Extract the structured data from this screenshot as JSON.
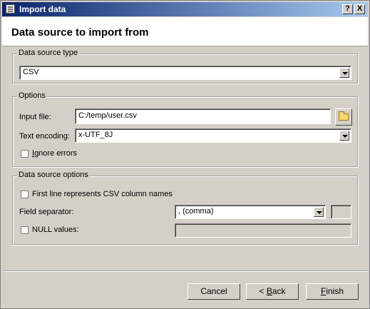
{
  "window": {
    "title": "Import data",
    "help_glyph": "?",
    "close_glyph": "X"
  },
  "header": {
    "title": "Data source to import from"
  },
  "source_type": {
    "group_label": "Data source type",
    "value": "CSV"
  },
  "options": {
    "group_label": "Options",
    "input_file_label": "Input file:",
    "input_file_value": "C:/temp/user.csv",
    "encoding_label": "Text encoding:",
    "encoding_value": "x-UTF_8J",
    "ignore_errors_prefix": "",
    "ignore_errors_underlined": "I",
    "ignore_errors_rest": "gnore errors"
  },
  "ds_options": {
    "group_label": "Data source options",
    "first_line_label": "First line represents CSV column names",
    "field_sep_label": "Field separator:",
    "field_sep_value": ", (comma)",
    "null_label": "NULL values:"
  },
  "buttons": {
    "cancel": "Cancel",
    "back_prefix": "< ",
    "back_u": "B",
    "back_rest": "ack",
    "finish_u": "F",
    "finish_rest": "inish"
  }
}
